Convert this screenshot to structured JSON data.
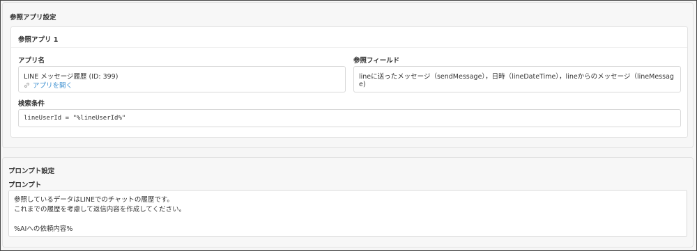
{
  "ref_app_settings": {
    "title": "参照アプリ設定",
    "card": {
      "title": "参照アプリ 1",
      "app_name_label": "アプリ名",
      "app_name_value": "LINE メッセージ履歴 (ID: 399)",
      "open_app_link": "アプリを開く",
      "ref_fields_label": "参照フィールド",
      "ref_fields_line1": "lineに送ったメッセージ（sendMessage），日時（lineDateTime），lineからのメッセージ（lineMessag",
      "ref_fields_line2": "e)",
      "condition_label": "検索条件",
      "condition_value": "lineUserId = \"%lineUserId%\""
    }
  },
  "prompt_settings": {
    "title": "プロンプト設定",
    "prompt_label": "プロンプト",
    "prompt_lines": [
      "参照しているデータはLINEでのチャットの履歴です。",
      "これまでの履歴を考慮して返信内容を作成してください。",
      "",
      "%AIへの依頼内容%"
    ]
  },
  "icons": {
    "open_app": "link-icon"
  },
  "colors": {
    "link": "#3c8fd0"
  }
}
